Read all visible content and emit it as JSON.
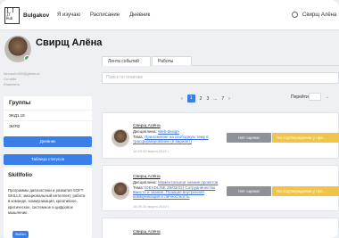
{
  "header": {
    "logo_text": "IT Hub",
    "brand": "Bulgakov",
    "nav": [
      "Я изучаю",
      "Расписание",
      "Дневник"
    ],
    "user_name": "Свирщ Алёна"
  },
  "profile": {
    "name": "Свирщ Алёна",
    "email": "Idunauto420@gitlab.ru",
    "status_text": "Онлайн",
    "edit_link": "Изменить"
  },
  "groups": {
    "title": "Группы",
    "items": [
      "ЭКД1.19",
      "ЭИЯ2"
    ]
  },
  "buttons": {
    "diary": "Дневник",
    "status_table": "Таблица статусов",
    "login": "Войти"
  },
  "skillfolio": {
    "title": "Skillfolio",
    "desc": "Программы диагностики и развития SOFT SKILLS: эмоциональный интеллект, работа в команде, коммуникация, креативное, критическое, системное и цифровое мышление."
  },
  "tabs": [
    {
      "label": "Лента событий",
      "active": false
    },
    {
      "label": "Работы",
      "active": true
    }
  ],
  "search": {
    "placeholder": "Поиск по ответам"
  },
  "pagination": {
    "pages": [
      "1",
      "2",
      "3",
      "...",
      "7"
    ],
    "current": "1",
    "goto_label": "Перейти",
    "next": "→",
    "prev": "‹",
    "after": "›"
  },
  "entries": [
    {
      "author": "Свирщ Алёна",
      "discipline_label": "Дисциплина:",
      "discipline": "Web-design",
      "topic_label": "Тема:",
      "topic": "Приложение на свободную тему в трасформирование (5 вариант)",
      "date": "16.09.30 марта 2022 г.",
      "grade": "Нет оценки",
      "status": "На подтверждении у пре..."
    },
    {
      "author": "Свирщ Алёна",
      "discipline_label": "Дисциплина:",
      "discipline": "Моментальное знание проектов",
      "topic_label": "Тема:",
      "topic": "IDEADLINE 28/03/22) Сотрудничество вместе и знание. Позиция внутренняя коммуникация и личностность",
      "date": "16.09.30 марта 2022 г.",
      "grade": "Нет оценки",
      "status": "На подтверждении у пре..."
    },
    {
      "author": "Свирщ Алёна",
      "discipline_label": "",
      "discipline": "",
      "topic_label": "",
      "topic": "",
      "date": "",
      "grade": "",
      "status": ""
    }
  ],
  "colors": {
    "accent": "#3a7fe8",
    "status_grey": "#8e9196",
    "status_yellow": "#f2c34a",
    "online": "#3fa35d"
  },
  "icons": [
    "theme-toggle-icon",
    "logo-icon"
  ]
}
